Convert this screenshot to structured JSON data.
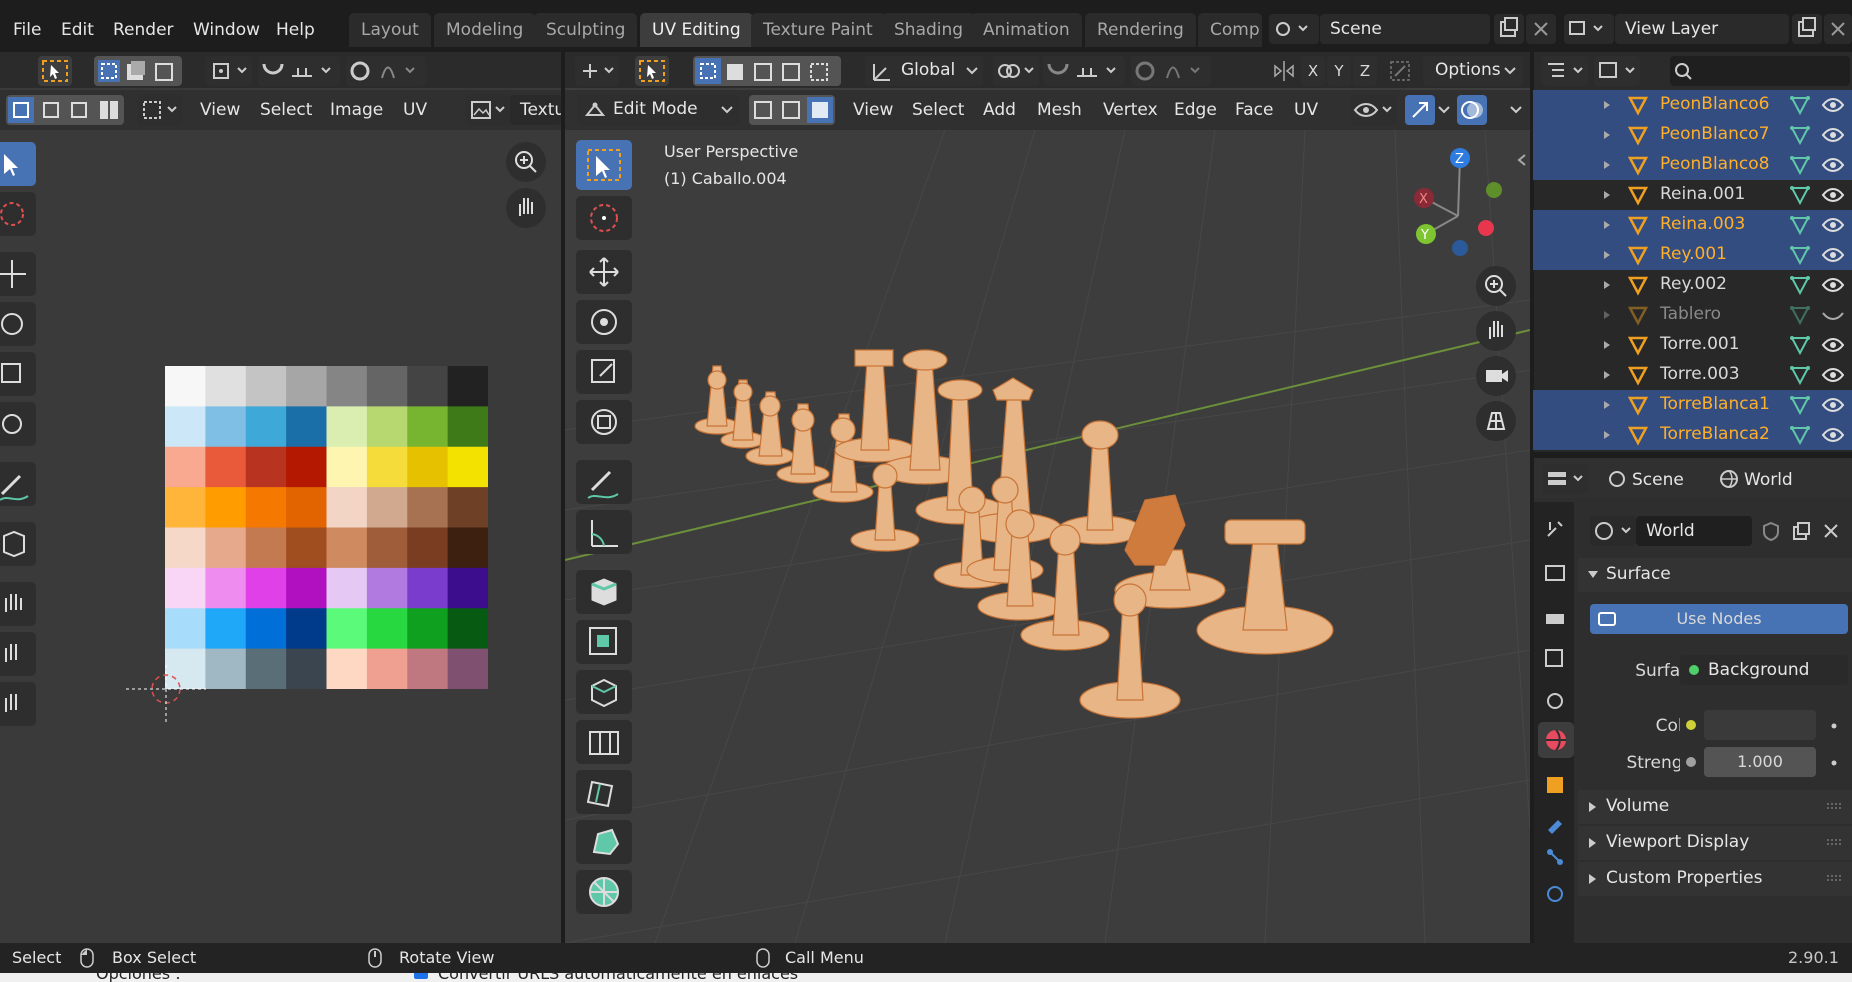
{
  "menu": {
    "file": "File",
    "edit": "Edit",
    "render": "Render",
    "window": "Window",
    "help": "Help"
  },
  "workspaces": [
    "Layout",
    "Modeling",
    "Sculpting",
    "UV Editing",
    "Texture Paint",
    "Shading",
    "Animation",
    "Rendering",
    "Comp"
  ],
  "active_workspace": "UV Editing",
  "scene": {
    "label": "Scene"
  },
  "view_layer": {
    "label": "View Layer"
  },
  "uv_editor": {
    "menus": {
      "view": "View",
      "select": "Select",
      "image": "Image",
      "uv": "UV"
    },
    "image_field": "Textu"
  },
  "viewport": {
    "mode": "Edit Mode",
    "orientation": "Global",
    "axes": {
      "x": "X",
      "y": "Y",
      "z": "Z"
    },
    "options": "Options",
    "menus": {
      "view": "View",
      "select": "Select",
      "add": "Add",
      "mesh": "Mesh",
      "vertex": "Vertex",
      "edge": "Edge",
      "face": "Face",
      "uv": "UV"
    },
    "overlay_title": "User Perspective",
    "overlay_object": "(1) Caballo.004",
    "gizmo": {
      "x": "X",
      "y": "Y",
      "z": "Z"
    }
  },
  "outliner": {
    "items": [
      {
        "name": "PeonBlanco6",
        "selected": true,
        "visible": true
      },
      {
        "name": "PeonBlanco7",
        "selected": true,
        "visible": true
      },
      {
        "name": "PeonBlanco8",
        "selected": true,
        "visible": true
      },
      {
        "name": "Reina.001",
        "selected": false,
        "visible": true
      },
      {
        "name": "Reina.003",
        "selected": true,
        "visible": true
      },
      {
        "name": "Rey.001",
        "selected": true,
        "visible": true
      },
      {
        "name": "Rey.002",
        "selected": false,
        "visible": true
      },
      {
        "name": "Tablero",
        "selected": false,
        "visible": false
      },
      {
        "name": "Torre.001",
        "selected": false,
        "visible": true
      },
      {
        "name": "Torre.003",
        "selected": false,
        "visible": true
      },
      {
        "name": "TorreBlanca1",
        "selected": true,
        "visible": true
      },
      {
        "name": "TorreBlanca2",
        "selected": true,
        "visible": true
      }
    ]
  },
  "properties": {
    "breadcrumb_scene": "Scene",
    "breadcrumb_world": "World",
    "world_name": "World",
    "surface_panel": "Surface",
    "use_nodes": "Use Nodes",
    "surface_label": "Surface",
    "surface_value": "Background",
    "color_label": "Color",
    "strength_label": "Strength",
    "strength_value": "1.000",
    "volume_panel": "Volume",
    "viewport_display_panel": "Viewport Display",
    "custom_properties_panel": "Custom Properties"
  },
  "status": {
    "select": "Select",
    "box_select": "Box Select",
    "rotate_view": "Rotate View",
    "call_menu": "Call Menu",
    "version": "2.90.1"
  },
  "behind_window": {
    "opciones": "Opciones :",
    "checkbox_text": "Convertir URLS automáticamente en enlaces"
  },
  "colors": {
    "accent": "#4772b3",
    "selected_text": "#ffaf29",
    "mesh_orange": "#e8a060"
  }
}
